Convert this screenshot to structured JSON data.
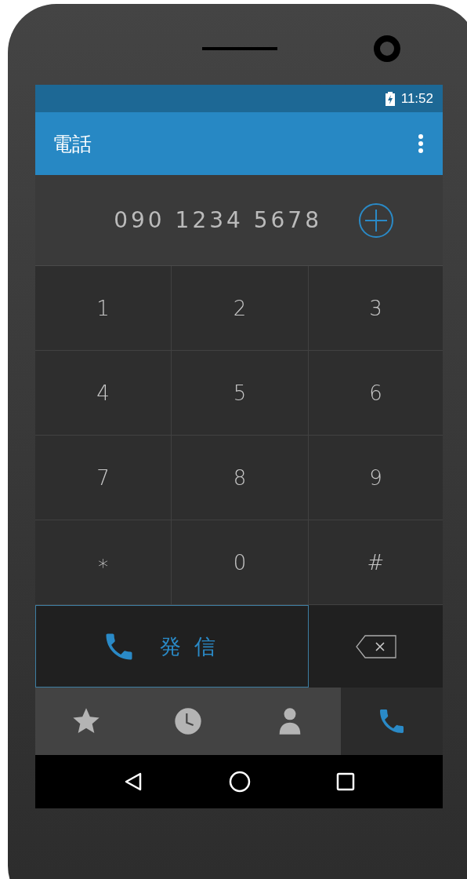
{
  "status_bar": {
    "time": "11:52",
    "charging": true
  },
  "app_bar": {
    "title": "電話"
  },
  "dialer": {
    "number": "090 1234 5678"
  },
  "keypad": [
    "1",
    "2",
    "3",
    "4",
    "5",
    "6",
    "7",
    "8",
    "9",
    "∗",
    "0",
    "#"
  ],
  "call_button": {
    "label": "発 信"
  },
  "tabs": [
    {
      "kind": "favorites",
      "selected": false
    },
    {
      "kind": "recents",
      "selected": false
    },
    {
      "kind": "contacts",
      "selected": false
    },
    {
      "kind": "dialpad",
      "selected": true
    }
  ]
}
